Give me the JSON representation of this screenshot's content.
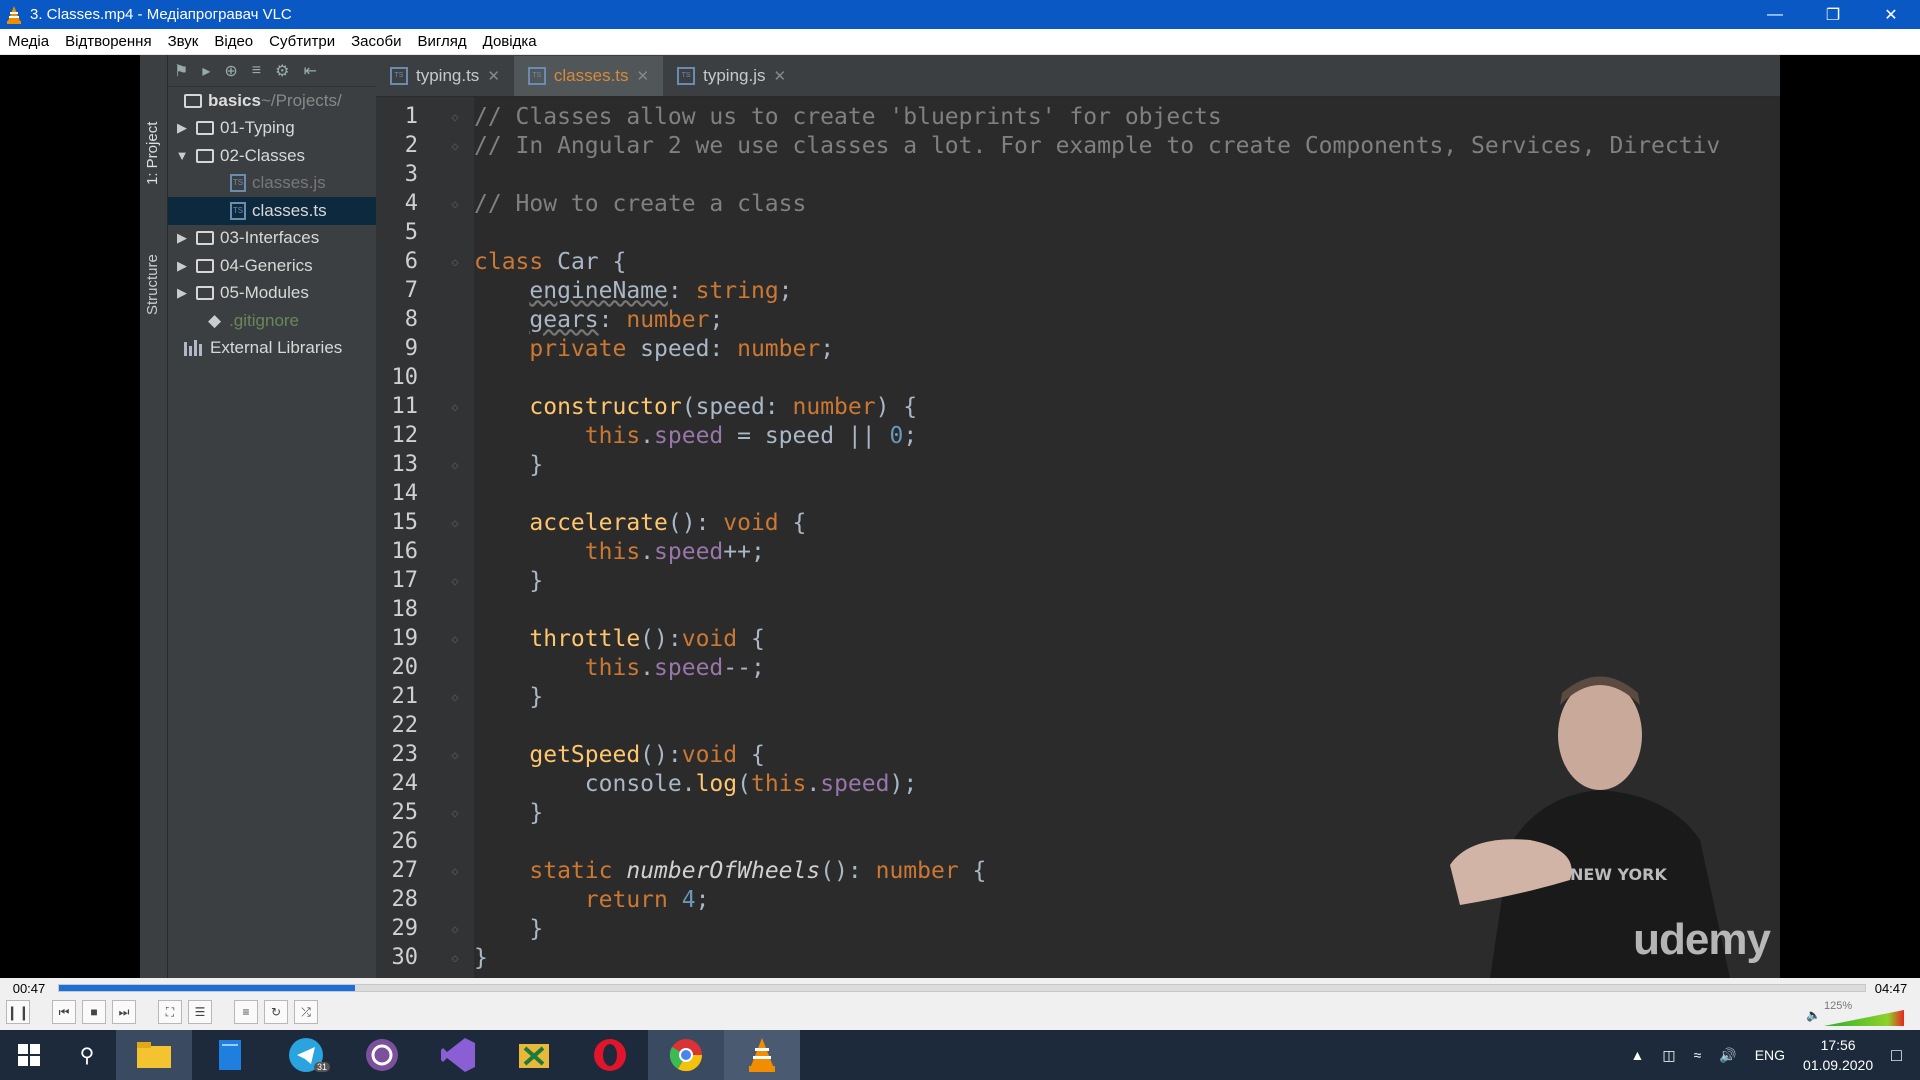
{
  "window": {
    "title": "3. Classes.mp4 - Медіапрогравач VLC",
    "controls": [
      "minimize",
      "restore",
      "close"
    ]
  },
  "menu": [
    "Медіа",
    "Відтворення",
    "Звук",
    "Відео",
    "Субтитри",
    "Засоби",
    "Вигляд",
    "Довідка"
  ],
  "ide": {
    "side_tabs": {
      "project": "1: Project",
      "structure": "Structure"
    },
    "tree": [
      {
        "label": "basics",
        "suffix": " ~/Projects/",
        "type": "root"
      },
      {
        "label": "01-Typing",
        "type": "folder",
        "expanded": false
      },
      {
        "label": "02-Classes",
        "type": "folder",
        "expanded": true
      },
      {
        "label": "classes.js",
        "type": "file-dim"
      },
      {
        "label": "classes.ts",
        "type": "file",
        "selected": true
      },
      {
        "label": "03-Interfaces",
        "type": "folder",
        "expanded": false
      },
      {
        "label": "04-Generics",
        "type": "folder",
        "expanded": false
      },
      {
        "label": "05-Modules",
        "type": "folder",
        "expanded": false
      },
      {
        "label": ".gitignore",
        "type": "git"
      },
      {
        "label": "External Libraries",
        "type": "lib"
      }
    ],
    "tabs": [
      {
        "label": "typing.ts",
        "active": false
      },
      {
        "label": "classes.ts",
        "active": true
      },
      {
        "label": "typing.js",
        "active": false
      }
    ],
    "code_lines": [
      {
        "n": "1",
        "code": "// Classes allow us to create 'blueprints' for objects"
      },
      {
        "n": "2",
        "code": "// In Angular 2 we use classes a lot. For example to create Components, Services, Directiv"
      },
      {
        "n": "3",
        "code": ""
      },
      {
        "n": "4",
        "code": "// How to create a class"
      },
      {
        "n": "5",
        "code": ""
      },
      {
        "n": "6",
        "code": "class Car {"
      },
      {
        "n": "7",
        "code": "    engineName: string;"
      },
      {
        "n": "8",
        "code": "    gears: number;"
      },
      {
        "n": "9",
        "code": "    private speed: number;"
      },
      {
        "n": "10",
        "code": ""
      },
      {
        "n": "11",
        "code": "    constructor(speed: number) {"
      },
      {
        "n": "12",
        "code": "        this.speed = speed || 0;"
      },
      {
        "n": "13",
        "code": "    }"
      },
      {
        "n": "14",
        "code": ""
      },
      {
        "n": "15",
        "code": "    accelerate(): void {"
      },
      {
        "n": "16",
        "code": "        this.speed++;"
      },
      {
        "n": "17",
        "code": "    }"
      },
      {
        "n": "18",
        "code": ""
      },
      {
        "n": "19",
        "code": "    throttle():void {"
      },
      {
        "n": "20",
        "code": "        this.speed--;"
      },
      {
        "n": "21",
        "code": "    }"
      },
      {
        "n": "22",
        "code": ""
      },
      {
        "n": "23",
        "code": "    getSpeed():void {"
      },
      {
        "n": "24",
        "code": "        console.log(this.speed);"
      },
      {
        "n": "25",
        "code": "    }"
      },
      {
        "n": "26",
        "code": ""
      },
      {
        "n": "27",
        "code": "    static numberOfWheels(): number {"
      },
      {
        "n": "28",
        "code": "        return 4;"
      },
      {
        "n": "29",
        "code": "    }"
      },
      {
        "n": "30",
        "code": "}"
      }
    ]
  },
  "watermark": "udemy",
  "player": {
    "elapsed": "00:47",
    "total": "04:47",
    "progress": 0.164,
    "volume_label": "125%",
    "volume": 1.25,
    "buttons": [
      "pause",
      "previous",
      "stop",
      "next",
      "fullscreen",
      "extended-settings",
      "playlist",
      "loop",
      "shuffle"
    ]
  },
  "taskbar": {
    "apps": [
      "file-explorer",
      "notes",
      "telegram",
      "viber",
      "visual-studio",
      "snipping-tool",
      "opera",
      "chrome",
      "vlc"
    ],
    "telegram_badge": "31",
    "lang": "ENG",
    "time": "17:56",
    "date": "01.09.2020"
  },
  "colors": {
    "titlebar": "#0a58c4",
    "taskbar": "#1c2a3c",
    "seek_fill": "#1c6fd6",
    "editor_bg": "#2b2b2b"
  }
}
